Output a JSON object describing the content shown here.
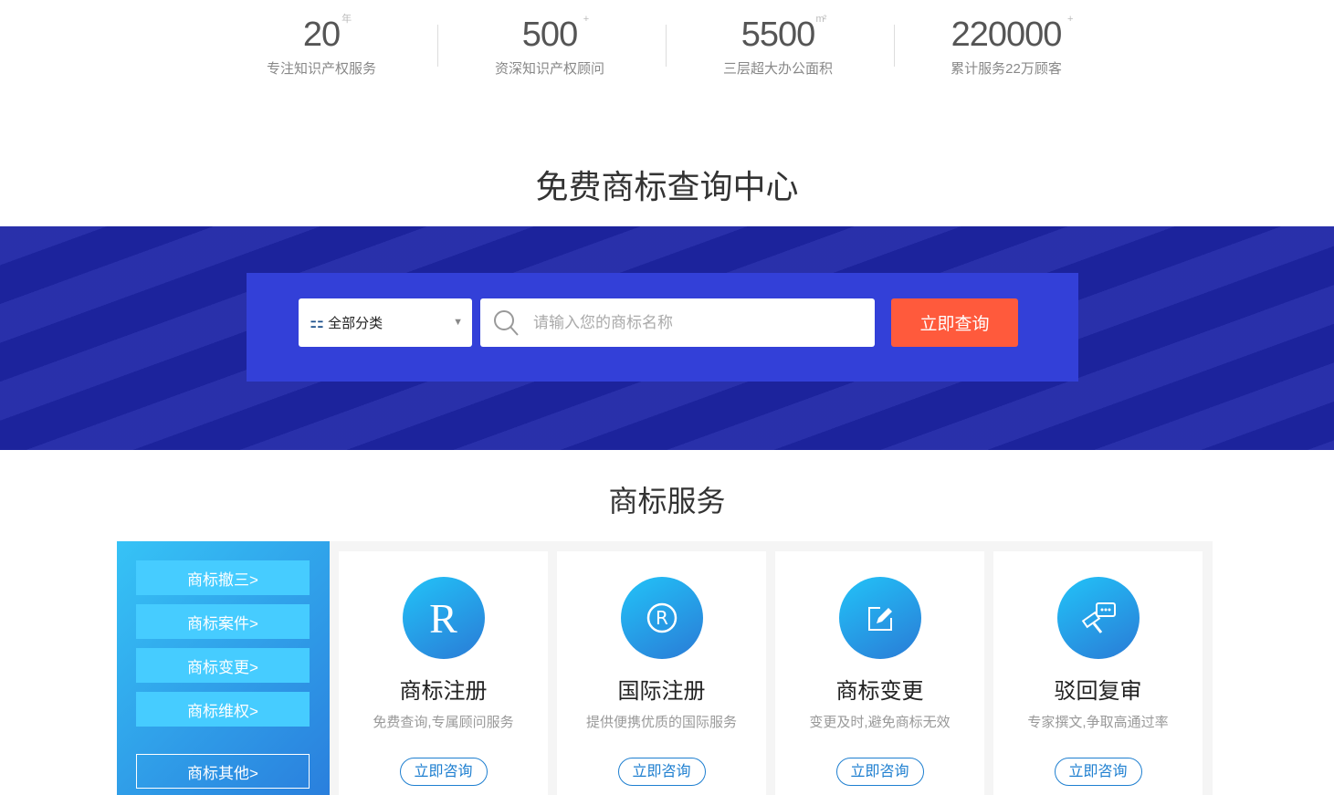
{
  "stats": [
    {
      "value": "20",
      "sup": "年",
      "label": "专注知识产权服务"
    },
    {
      "value": "500",
      "sup": "+",
      "label": "资深知识产权顾问"
    },
    {
      "value": "5500",
      "sup": "m²",
      "label": "三层超大办公面积"
    },
    {
      "value": "220000",
      "sup": "+",
      "label": "累计服务22万顾客"
    }
  ],
  "query_title": "免费商标查询中心",
  "search": {
    "category": "全部分类",
    "placeholder": "请输入您的商标名称",
    "button": "立即查询"
  },
  "services_title": "商标服务",
  "side_menu": [
    "商标撤三>",
    "商标案件>",
    "商标变更>",
    "商标维权>",
    "商标其他>"
  ],
  "cards": [
    {
      "icon": "r-letter-icon",
      "title": "商标注册",
      "desc": "免费查询,专属顾问服务",
      "button": "立即咨询"
    },
    {
      "icon": "registered-icon",
      "title": "国际注册",
      "desc": "提供便携优质的国际服务",
      "button": "立即咨询"
    },
    {
      "icon": "edit-icon",
      "title": "商标变更",
      "desc": "变更及时,避免商标无效",
      "button": "立即咨询"
    },
    {
      "icon": "gavel-chat-icon",
      "title": "驳回复审",
      "desc": "专家撰文,争取高通过率",
      "button": "立即咨询"
    }
  ],
  "colors": {
    "banner": "#1e25a6",
    "search_box": "#3340d8",
    "query_button": "#ff5a3c",
    "accent": "#1e7fd0"
  }
}
